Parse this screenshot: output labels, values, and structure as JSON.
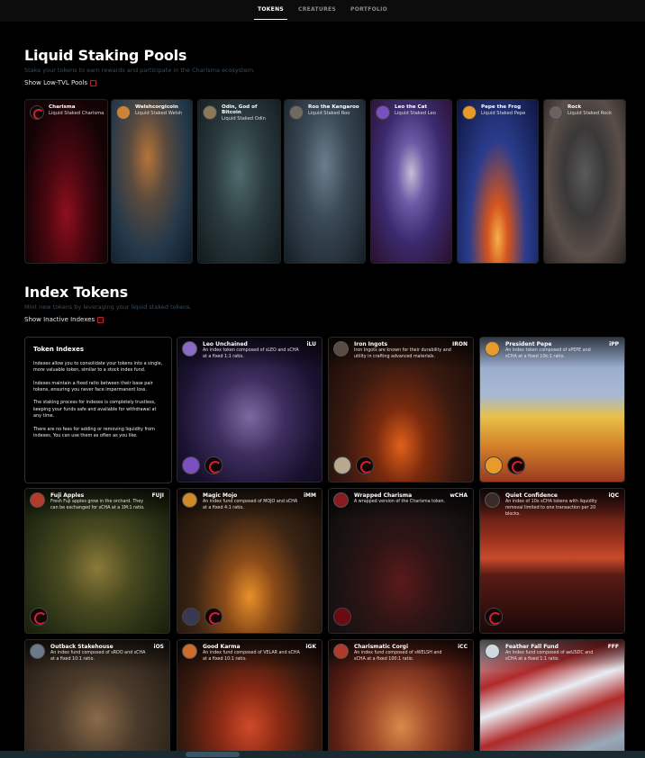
{
  "nav": {
    "tabs": [
      "TOKENS",
      "CREATURES",
      "PORTFOLIO"
    ]
  },
  "staking": {
    "title": "Liquid Staking Pools",
    "subtitle": "Stake your tokens to earn rewards and participate in the Charisma ecosystem.",
    "toggle": "Show Low-TVL Pools",
    "pools": [
      {
        "name": "Charisma",
        "sub": "Liquid Staked Charisma"
      },
      {
        "name": "Welshcorgicoin",
        "sub": "Liquid Staked Welsh"
      },
      {
        "name": "Odin, God of Bitcoin",
        "sub": "Liquid Staked Odin"
      },
      {
        "name": "Roo the Kangaroo",
        "sub": "Liquid Staked Roo"
      },
      {
        "name": "Leo the Cat",
        "sub": "Liquid Staked Leo"
      },
      {
        "name": "Pepe the Frog",
        "sub": "Liquid Staked Pepe"
      },
      {
        "name": "Rock",
        "sub": "Liquid Staked Rock"
      }
    ]
  },
  "index": {
    "title": "Index Tokens",
    "subtitle": "Mint new tokens by leveraging your liquid staked tokens.",
    "toggle": "Show Inactive Indexes",
    "info": {
      "title": "Token Indexes",
      "p1": "Indexes allow you to consolidate your tokens into a single, more valuable token, similar to a stock index fund.",
      "p2": "Indexes maintain a fixed ratio between their base pair tokens, ensuring you never face impermanent loss.",
      "p3": "The staking process for indexes is completely trustless, keeping your funds safe and available for withdrawal at any time.",
      "p4": "There are no fees for adding or removing liquidity from indexes. You can use them as often as you like."
    },
    "cards": [
      {
        "name": "Leo Unchained",
        "sym": "iLU",
        "desc": "An index token composed of sLEO and sCHA at a fixed 1:1 ratio."
      },
      {
        "name": "Iron Ingots",
        "sym": "IRON",
        "desc": "Iron Ingots are known for their durability and utility in crafting advanced materials."
      },
      {
        "name": "President Pepe",
        "sym": "iPP",
        "desc": "An index token composed of sPEPE and sCHA at a fixed 10k:1 ratio."
      },
      {
        "name": "Fuji Apples",
        "sym": "FUJI",
        "desc": "Fresh Fuji apples grow in the orchard. They can be exchanged for sCHA at a 1M:1 ratio."
      },
      {
        "name": "Magic Mojo",
        "sym": "iMM",
        "desc": "An index fund composed of MOJO and sCHA at a fixed 4:1 ratio."
      },
      {
        "name": "Wrapped Charisma",
        "sym": "wCHA",
        "desc": "A wrapped version of the Charisma token."
      },
      {
        "name": "Quiet Confidence",
        "sym": "iQC",
        "desc": "An index of 10x sCHA tokens with liquidity removal limited to one transaction per 20 blocks."
      },
      {
        "name": "Outback Stakehouse",
        "sym": "iOS",
        "desc": "An index fund composed of sROO and sCHA at a fixed 10:1 ratio."
      },
      {
        "name": "Good Karma",
        "sym": "iGK",
        "desc": "An index fund composed of VELAR and sCHA at a fixed 10:1 ratio."
      },
      {
        "name": "Charismatic Corgi",
        "sym": "iCC",
        "desc": "An index fund composed of sWELSH and sCHA at a fixed 100:1 ratio."
      },
      {
        "name": "Feather Fall Fund",
        "sym": "FFF",
        "desc": "An index fund composed of aeUSDC and sCHA at a fixed 1:1 ratio."
      }
    ]
  },
  "colors": {
    "accent": "#d0202f",
    "bg": "#000000",
    "subtitle": "#3b4d5a"
  }
}
